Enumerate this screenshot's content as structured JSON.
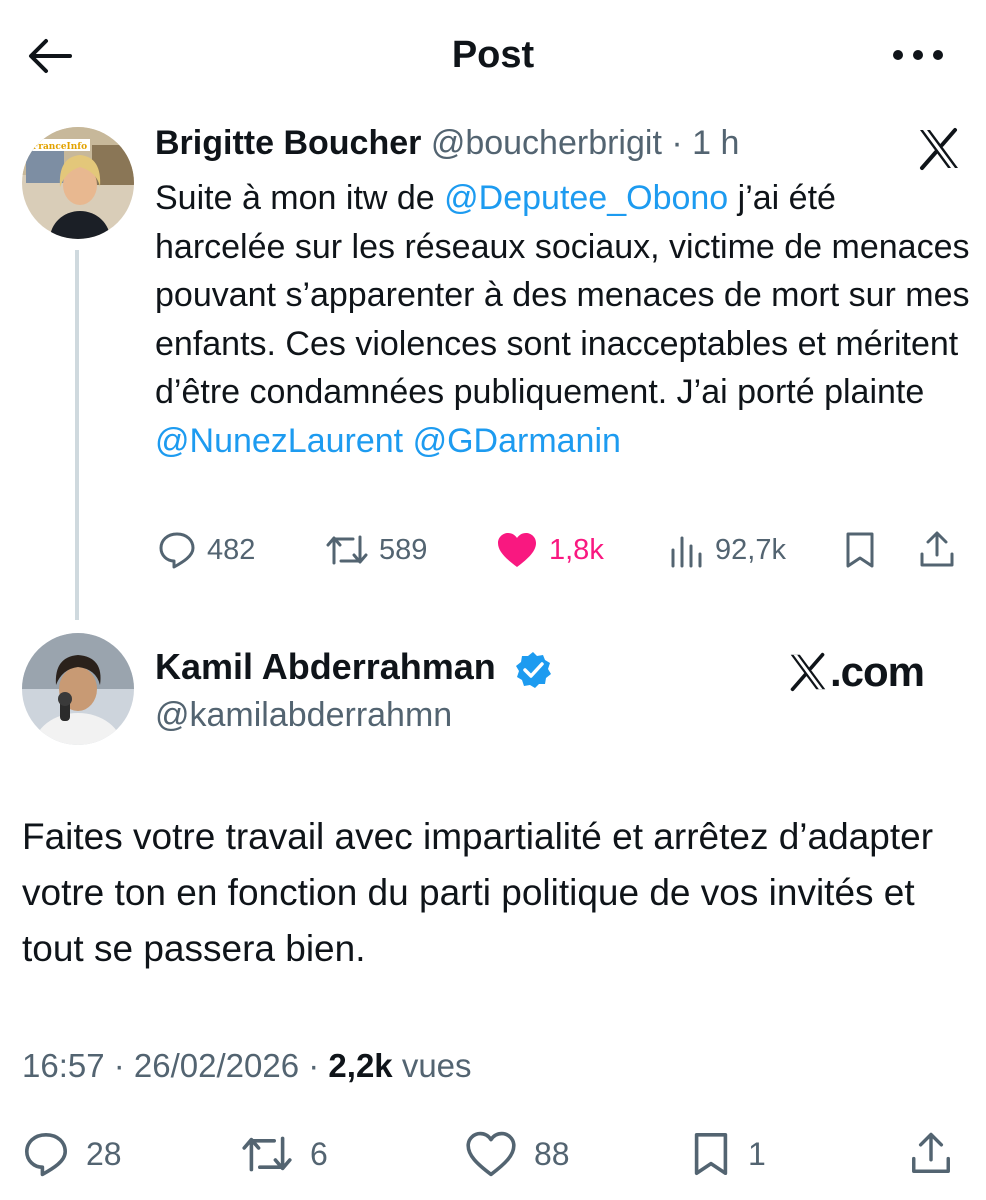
{
  "header": {
    "title": "Post"
  },
  "quoted": {
    "name": "Brigitte Boucher",
    "handle": "@boucherbrigit",
    "dot": " · ",
    "time": "1 h",
    "text_parts": [
      "Suite à mon itw de ",
      "@Deputee_Obono",
      " j’ai été harcelée sur les réseaux sociaux, victime de menaces pouvant s’apparenter à des menaces de mort sur mes enfants. Ces violences sont inacceptables et méritent d’être condamnées publiquement. J’ai porté plainte ",
      "@NunezLaurent",
      " ",
      "@GDarmanin"
    ],
    "avatar_text": "FranceInfo",
    "stats": {
      "replies": "482",
      "reposts": "589",
      "likes": "1,8k",
      "views": "92,7k"
    }
  },
  "post": {
    "name": "Kamil Abderrahman",
    "handle": "@kamilabderrahmn",
    "watermark": ".com",
    "text": "Faites votre travail avec impartialité et arrêtez d’adapter votre ton en fonction du parti politique de vos invités et tout se passera bien.",
    "time": "16:57",
    "sep1": " · ",
    "date": "26/02/2026",
    "sep2": " · ",
    "views": "2,2k",
    "views_label": " vues",
    "stats": {
      "replies": "28",
      "reposts": "6",
      "likes": "88",
      "bookmarks": "1"
    }
  },
  "colors": {
    "text": "#0f1419",
    "secondary": "#536471",
    "link": "#1d9bf0",
    "like": "#f91880",
    "thread_line": "#cfd9de"
  },
  "icons": [
    "back-arrow-icon",
    "more-icon",
    "x-logo-icon",
    "reply-icon",
    "repost-icon",
    "heart-icon",
    "views-icon",
    "bookmark-icon",
    "share-icon",
    "verified-icon"
  ]
}
